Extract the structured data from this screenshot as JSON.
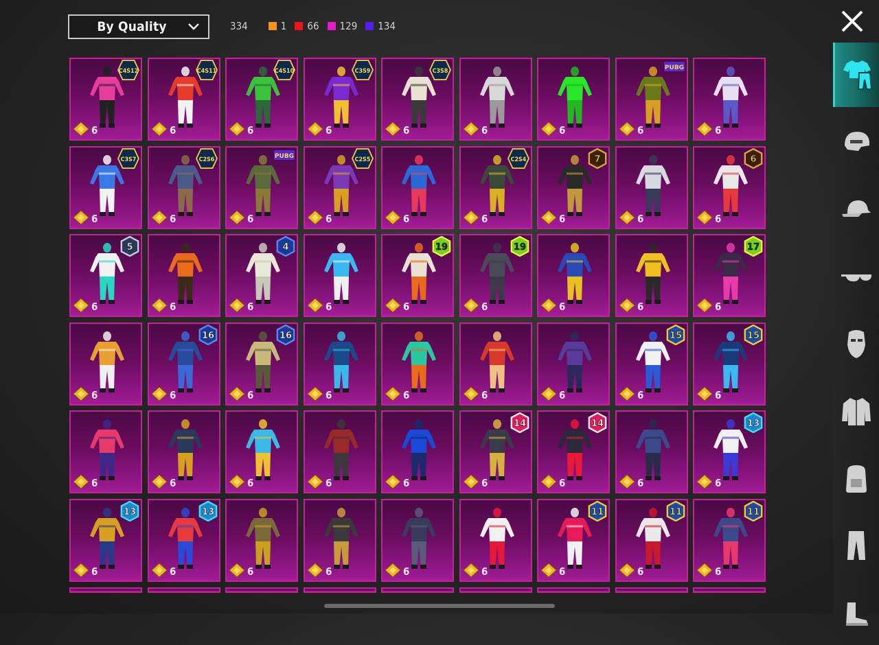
{
  "toolbar": {
    "sort_label": "By Quality",
    "total": "334",
    "quality_counts": [
      {
        "color": "#f6931e",
        "value": "1"
      },
      {
        "color": "#e8141e",
        "value": "66"
      },
      {
        "color": "#e91aca",
        "value": "129"
      },
      {
        "color": "#5a1eea",
        "value": "134"
      }
    ],
    "close_icon": "close-icon"
  },
  "sidebar": {
    "tabs": [
      {
        "name": "outfit",
        "icon": "shirt-pants-icon",
        "active": true
      },
      {
        "name": "helmet",
        "icon": "helmet-icon",
        "active": false
      },
      {
        "name": "cap",
        "icon": "cap-icon",
        "active": false
      },
      {
        "name": "glasses",
        "icon": "glasses-icon",
        "active": false
      },
      {
        "name": "mask",
        "icon": "mask-icon",
        "active": false
      },
      {
        "name": "jacket",
        "icon": "jacket-icon",
        "active": false
      },
      {
        "name": "backpack",
        "icon": "backpack-icon",
        "active": false
      },
      {
        "name": "pants",
        "icon": "pants-icon",
        "active": false
      },
      {
        "name": "shoes",
        "icon": "shoes-icon",
        "active": false
      }
    ]
  },
  "items": [
    [
      {
        "badge": "C4S12",
        "badge_type": "season",
        "qty": "6",
        "c1": "#e83c9c",
        "c2": "#222"
      },
      {
        "badge": "C4S11",
        "badge_type": "season",
        "qty": "6",
        "c1": "#e83a2a",
        "c2": "#f2f2f2"
      },
      {
        "badge": "C4S10",
        "badge_type": "season",
        "qty": "6",
        "c1": "#39c23a",
        "c2": "#2a6a3a"
      },
      {
        "badge": "C3S9",
        "badge_type": "season",
        "qty": "6",
        "c1": "#7a2ad2",
        "c2": "#f0c030"
      },
      {
        "badge": "C3S8",
        "badge_type": "season",
        "qty": "6",
        "c1": "#e8e0d0",
        "c2": "#3a3a3a"
      },
      {
        "badge": "",
        "badge_type": "",
        "qty": "6",
        "c1": "#d8d8d8",
        "c2": "#9a9a9a"
      },
      {
        "badge": "",
        "badge_type": "",
        "qty": "6",
        "c1": "#28e628",
        "c2": "#22b822"
      },
      {
        "badge": "PUBG",
        "badge_type": "brand",
        "qty": "6",
        "c1": "#6a7a1a",
        "c2": "#d8a020"
      },
      {
        "badge": "",
        "badge_type": "",
        "qty": "6",
        "c1": "#e8e0f0",
        "c2": "#5a5ac8"
      }
    ],
    [
      {
        "badge": "C3S7",
        "badge_type": "season",
        "qty": "6",
        "c1": "#3a7ae8",
        "c2": "#f2f2f2"
      },
      {
        "badge": "C2S6",
        "badge_type": "season",
        "qty": "6",
        "c1": "#4a5a8a",
        "c2": "#8a6a4a"
      },
      {
        "badge": "PUBG",
        "badge_type": "brand",
        "qty": "6",
        "c1": "#5a6a3a",
        "c2": "#8a7a3a"
      },
      {
        "badge": "C2S5",
        "badge_type": "season",
        "qty": "6",
        "c1": "#7a3ab8",
        "c2": "#d8a020"
      },
      {
        "badge": "",
        "badge_type": "",
        "qty": "6",
        "c1": "#2a6ad8",
        "c2": "#e83a5a"
      },
      {
        "badge": "C2S4",
        "badge_type": "season",
        "qty": "6",
        "c1": "#3a4a3a",
        "c2": "#d8b020"
      },
      {
        "badge": "7",
        "badge_type": "rp-gold",
        "qty": "6",
        "c1": "#2a2a2a",
        "c2": "#c09a3a"
      },
      {
        "badge": "",
        "badge_type": "",
        "qty": "6",
        "c1": "#d8d8e0",
        "c2": "#3a3a5a"
      },
      {
        "badge": "6",
        "badge_type": "rp-gold",
        "qty": "6",
        "c1": "#e8e8e8",
        "c2": "#e83a3a"
      }
    ],
    [
      {
        "badge": "5",
        "badge_type": "rp-silver",
        "qty": "6",
        "c1": "#f0f0f0",
        "c2": "#28d8c0"
      },
      {
        "badge": "",
        "badge_type": "",
        "qty": "6",
        "c1": "#e86a1a",
        "c2": "#3a2a1a"
      },
      {
        "badge": "4",
        "badge_type": "rp-blue",
        "qty": "6",
        "c1": "#e8e8d8",
        "c2": "#c8c8b8"
      },
      {
        "badge": "",
        "badge_type": "",
        "qty": "6",
        "c1": "#3ab8f0",
        "c2": "#f0f0f0"
      },
      {
        "badge": "19",
        "badge_type": "rp-lime",
        "qty": "6",
        "c1": "#e8e0d0",
        "c2": "#e86a1a"
      },
      {
        "badge": "19",
        "badge_type": "rp-lime",
        "qty": "6",
        "c1": "#4a4a5a",
        "c2": "#3a3a4a"
      },
      {
        "badge": "",
        "badge_type": "",
        "qty": "6",
        "c1": "#2a4ab8",
        "c2": "#e8c020"
      },
      {
        "badge": "",
        "badge_type": "",
        "qty": "6",
        "c1": "#f0c020",
        "c2": "#2a2a2a"
      },
      {
        "badge": "17",
        "badge_type": "rp-lime",
        "qty": "6",
        "c1": "#3a2a4a",
        "c2": "#e83aa8"
      }
    ],
    [
      {
        "badge": "",
        "badge_type": "",
        "qty": "6",
        "c1": "#e8a030",
        "c2": "#f0f0f0"
      },
      {
        "badge": "16",
        "badge_type": "rp-blue",
        "qty": "6",
        "c1": "#2a4a9a",
        "c2": "#3a6ad8"
      },
      {
        "badge": "16",
        "badge_type": "rp-blue",
        "qty": "6",
        "c1": "#c8b87a",
        "c2": "#5a5a3a"
      },
      {
        "badge": "",
        "badge_type": "",
        "qty": "6",
        "c1": "#1a4a8a",
        "c2": "#3ab8e8"
      },
      {
        "badge": "",
        "badge_type": "",
        "qty": "6",
        "c1": "#28c8a0",
        "c2": "#e86a1a"
      },
      {
        "badge": "",
        "badge_type": "",
        "qty": "6",
        "c1": "#d83a2a",
        "c2": "#f0c080"
      },
      {
        "badge": "",
        "badge_type": "",
        "qty": "6",
        "c1": "#5a3a9a",
        "c2": "#2a2a5a"
      },
      {
        "badge": "15",
        "badge_type": "rp-yellow",
        "qty": "6",
        "c1": "#f0f0f0",
        "c2": "#2a5ad8"
      },
      {
        "badge": "15",
        "badge_type": "rp-yellow",
        "qty": "6",
        "c1": "#1a3a7a",
        "c2": "#3ab8f0"
      }
    ],
    [
      {
        "badge": "",
        "badge_type": "",
        "qty": "6",
        "c1": "#e83a6a",
        "c2": "#3a2a8a"
      },
      {
        "badge": "",
        "badge_type": "",
        "qty": "6",
        "c1": "#2a3a5a",
        "c2": "#d8a020"
      },
      {
        "badge": "",
        "badge_type": "",
        "qty": "6",
        "c1": "#3ab8e8",
        "c2": "#f0c030"
      },
      {
        "badge": "",
        "badge_type": "",
        "qty": "6",
        "c1": "#9a2a2a",
        "c2": "#3a3a3a"
      },
      {
        "badge": "",
        "badge_type": "",
        "qty": "6",
        "c1": "#1a4ad8",
        "c2": "#1a2a6a"
      },
      {
        "badge": "14",
        "badge_type": "rp-red",
        "qty": "6",
        "c1": "#3a3a4a",
        "c2": "#d8b040"
      },
      {
        "badge": "14",
        "badge_type": "rp-red",
        "qty": "6",
        "c1": "#2a2a3a",
        "c2": "#e81a3a"
      },
      {
        "badge": "",
        "badge_type": "",
        "qty": "6",
        "c1": "#3a4a8a",
        "c2": "#2a2a4a"
      },
      {
        "badge": "13",
        "badge_type": "rp-cyan",
        "qty": "6",
        "c1": "#f0f0f0",
        "c2": "#3a3ad8"
      }
    ],
    [
      {
        "badge": "13",
        "badge_type": "rp-cyan",
        "qty": "6",
        "c1": "#d8a020",
        "c2": "#2a3a8a"
      },
      {
        "badge": "13",
        "badge_type": "rp-cyan",
        "qty": "6",
        "c1": "#e83a3a",
        "c2": "#2a4ad8"
      },
      {
        "badge": "",
        "badge_type": "",
        "qty": "6",
        "c1": "#7a6a3a",
        "c2": "#c8a020"
      },
      {
        "badge": "",
        "badge_type": "",
        "qty": "6",
        "c1": "#3a3a3a",
        "c2": "#c89a3a"
      },
      {
        "badge": "",
        "badge_type": "",
        "qty": "6",
        "c1": "#3a3a5a",
        "c2": "#5a5a7a"
      },
      {
        "badge": "",
        "badge_type": "",
        "qty": "6",
        "c1": "#f0f0f0",
        "c2": "#e81a3a"
      },
      {
        "badge": "11",
        "badge_type": "rp-yellow",
        "qty": "6",
        "c1": "#e81a5a",
        "c2": "#f0f0f0"
      },
      {
        "badge": "11",
        "badge_type": "rp-yellow",
        "qty": "6",
        "c1": "#e8e8e8",
        "c2": "#c81a2a"
      },
      {
        "badge": "11",
        "badge_type": "rp-yellow",
        "qty": "6",
        "c1": "#3a4a8a",
        "c2": "#e83a6a"
      }
    ]
  ]
}
